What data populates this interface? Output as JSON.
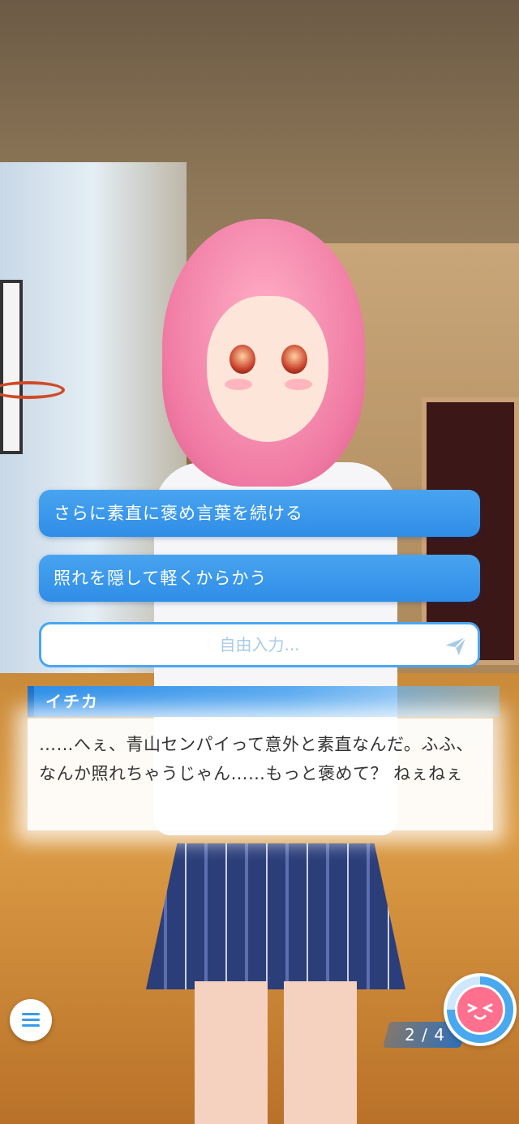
{
  "choices": [
    {
      "label": "さらに素直に褒め言葉を続ける"
    },
    {
      "label": "照れを隠して軽くからかう"
    }
  ],
  "free_input": {
    "placeholder": "自由入力..."
  },
  "dialogue": {
    "speaker": "イチカ",
    "text": "……へぇ、青山センパイって意外と素直なんだ。ふふ、なんか照れちゃうじゃん……もっと褒めて？ ねぇねぇ"
  },
  "hud": {
    "page": "2 / 4",
    "menu_icon": "hamburger-menu-icon",
    "emotion_icon": "embarrassed-face-icon",
    "emotion_gauge_level": 0.75
  },
  "colors": {
    "accent_blue": "#2f8de6",
    "hair_pink": "#f07aa3",
    "emotion_pink": "#ff6f8e"
  }
}
